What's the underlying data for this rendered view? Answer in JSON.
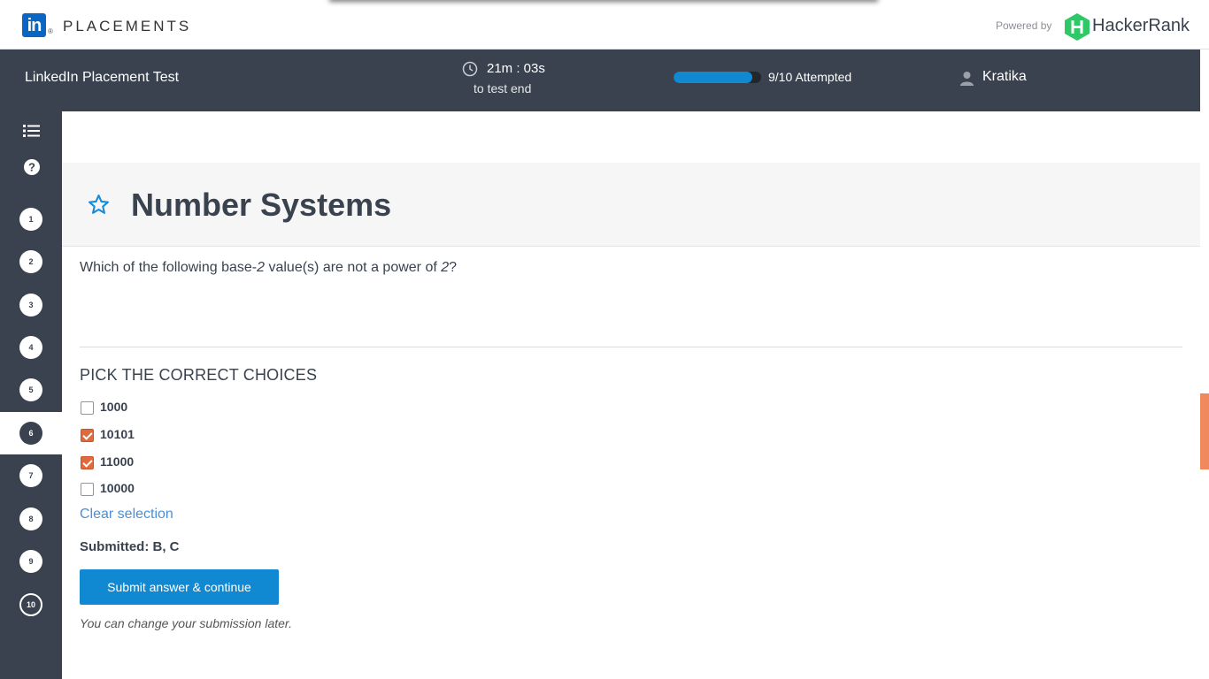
{
  "brand": {
    "placements": "PLACEMENTS",
    "powered_by": "Powered by",
    "hackerrank": "HackerRank",
    "linkedin_logo_letters": "in",
    "registered_mark": "®"
  },
  "header": {
    "test_title": "LinkedIn Placement Test",
    "timer_value": "21m : 03s",
    "timer_sub": "to test end",
    "progress_fraction": 0.9,
    "attempted": "9/10 Attempted",
    "user_name": "Kratika"
  },
  "sidebar": {
    "icons": [
      "list-icon",
      "help-icon"
    ],
    "questions": [
      "1",
      "2",
      "3",
      "4",
      "5",
      "6",
      "7",
      "8",
      "9",
      "10"
    ],
    "active_question": "6"
  },
  "question": {
    "title": "Number Systems",
    "text_parts": [
      "Which of the following base-",
      "2",
      " value(s) are not a power of ",
      "2",
      "?"
    ],
    "pick_label": "PICK THE CORRECT CHOICES",
    "choices": [
      {
        "label": "1000",
        "checked": false
      },
      {
        "label": "10101",
        "checked": true
      },
      {
        "label": "11000",
        "checked": true
      },
      {
        "label": "10000",
        "checked": false
      }
    ],
    "clear_label": "Clear selection",
    "submitted": "Submitted: B, C",
    "submit_label": "Submit answer & continue",
    "note": "You can change your submission later."
  },
  "colors": {
    "header_bg": "#39424e",
    "accent_blue": "#1189d2",
    "checked_orange": "#e06a3b",
    "hackerrank_green": "#2ec866"
  }
}
